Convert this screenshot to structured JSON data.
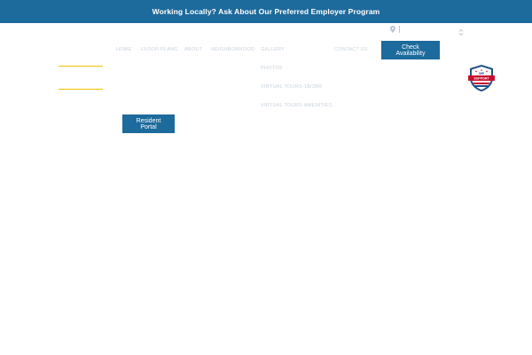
{
  "banner": {
    "text": "Working Locally? Ask About Our Preferred Employer Program"
  },
  "nav": {
    "items": [
      {
        "key": "home",
        "label": "Home"
      },
      {
        "key": "floor-plans",
        "label": "Floor Plans"
      },
      {
        "key": "about",
        "label": "About"
      },
      {
        "key": "neighborhood",
        "label": "Neighborhood"
      },
      {
        "key": "gallery",
        "label": "Gallery"
      },
      {
        "key": "contact-us",
        "label": "Contact Us"
      }
    ],
    "gallery_submenu": [
      {
        "label": "Photos"
      },
      {
        "label": "Virtual Tours-1B/2BR"
      },
      {
        "label": "Virtual Tours-Amenities"
      }
    ],
    "cta_label": "Check Availability"
  },
  "portal": {
    "label": "Resident Portal"
  },
  "badge": {
    "text_top": "WE",
    "text_bottom": "SUPPORT"
  },
  "colors": {
    "primary": "#1d6a9c",
    "accent": "#f2c200",
    "nav_text": "#c9d2dc",
    "badge_red": "#c8102e"
  },
  "icons": {
    "location": "map-pin-icon",
    "dropdown": "chevron-updown-icon"
  }
}
